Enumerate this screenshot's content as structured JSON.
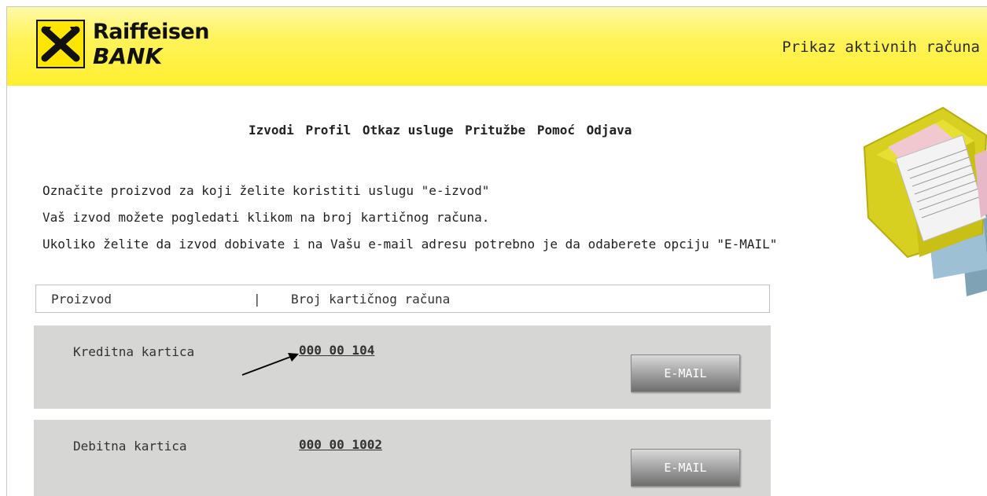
{
  "header": {
    "logo_line1": "Raiffeisen",
    "logo_line2": "BANK",
    "page_title": "Prikaz aktivnih računa",
    "brand_yellow": "#fff35a"
  },
  "nav": {
    "items": [
      "Izvodi",
      "Profil",
      "Otkaz usluge",
      "Pritužbe",
      "Pomoć",
      "Odjava"
    ]
  },
  "info": {
    "line1": "Označite proizvod za koji želite koristiti uslugu \"e-izvod\"",
    "line2": "Vaš izvod možete pogledati klikom na broj kartičnog računa.",
    "line3": "Ukoliko želite da izvod dobivate i na Vašu e-mail adresu potrebno je da odaberete opciju \"E-MAIL\""
  },
  "table": {
    "col_product": "Proizvod",
    "separator": "|",
    "col_account": "Broj kartičnog računa",
    "rows": [
      {
        "product": "Kreditna kartica",
        "account": "000 00 104",
        "button": "E-MAIL"
      },
      {
        "product": "Debitna kartica",
        "account": "000 00 1002",
        "button": "E-MAIL"
      }
    ]
  },
  "icons": {
    "logo": "raiffeisen-crossed-horse-heads-logo",
    "decoration": "mailbox-with-statements-illustration",
    "annotation": "arrow-pointer-icon"
  }
}
